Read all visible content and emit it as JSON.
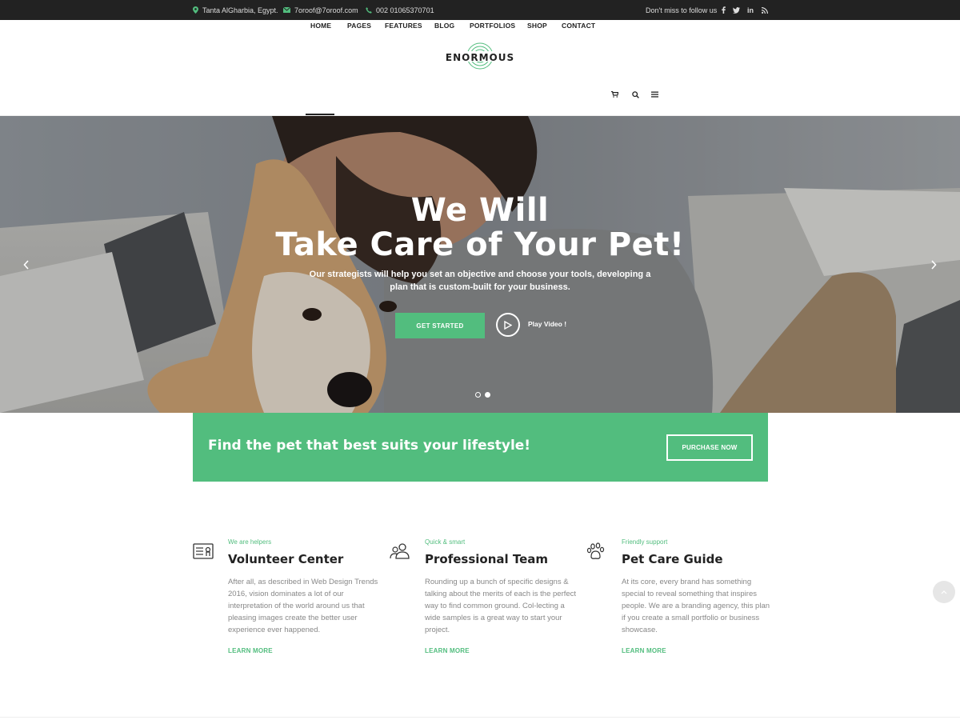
{
  "topbar": {
    "address": "Tanta AlGharbia, Egypt.",
    "email": "7oroof@7oroof.com",
    "phone": "002 01065370701",
    "follow_text": "Don't miss to follow us",
    "social_icons": [
      "facebook-icon",
      "twitter-icon",
      "linkedin-icon",
      "rss-icon"
    ]
  },
  "header": {
    "logo_text": "ENORMOUS",
    "nav": [
      "HOME",
      "PAGES",
      "FEATURES",
      "BLOG",
      "PORTFOLIOS",
      "SHOP",
      "CONTACT"
    ],
    "active_nav": "HOME",
    "nav_icons": [
      "cart-icon",
      "search-icon",
      "menu-icon"
    ]
  },
  "hero": {
    "title_line1": "We Will",
    "title_line2": "Take Care of Your Pet!",
    "subtitle": "Our strategists will help you set an objective and choose your tools, developing a plan that is custom-built for your business.",
    "cta_label": "GET STARTED",
    "play_label": "Play Video !",
    "slide_count": 2,
    "active_slide": 2
  },
  "banner": {
    "text": "Find the pet that best suits your lifestyle!",
    "button_label": "PURCHASE NOW"
  },
  "features": [
    {
      "icon": "id-card-icon",
      "kicker": "We are helpers",
      "title": "Volunteer Center",
      "description": "After all, as described in Web Design Trends 2016, vision dominates a lot of our interpretation of the world around us that pleasing images create the better user experience ever happened.",
      "link": "LEARN MORE"
    },
    {
      "icon": "team-icon",
      "kicker": "Quick & smart",
      "title": "Professional Team",
      "description": "Rounding up a bunch of specific designs & talking about the merits of each is the perfect way to find common ground. Col-lecting a wide samples is a great way to start your project.",
      "link": "LEARN MORE"
    },
    {
      "icon": "paw-icon",
      "kicker": "Friendly support",
      "title": "Pet Care Guide",
      "description": "At its core, every brand has something special to reveal something that inspires people. We are a branding agency, this plan if you create a small portfolio or business showcase.",
      "link": "LEARN MORE"
    }
  ],
  "colors": {
    "accent": "#52bd7e",
    "topbar_bg": "#222222",
    "heading": "#222222",
    "body_text": "#888888"
  }
}
